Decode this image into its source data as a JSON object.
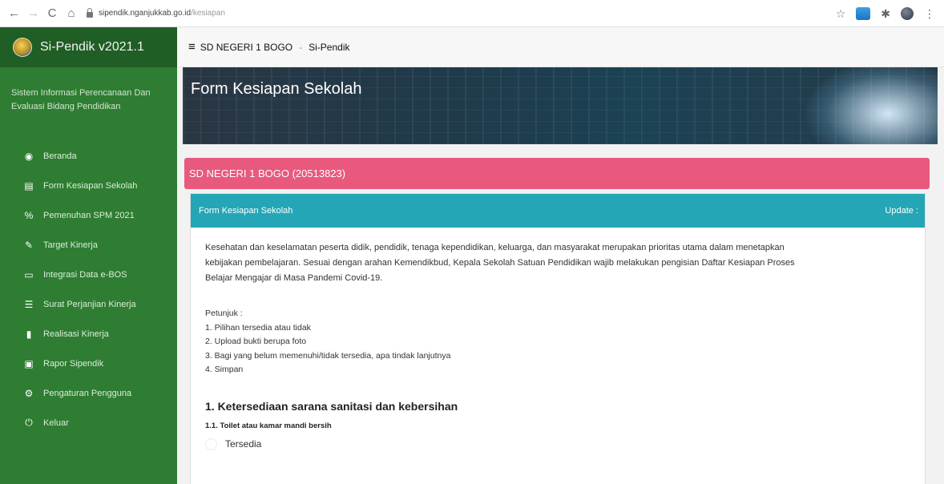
{
  "browser": {
    "url_host": "sipendik.nganjukkab.go.id",
    "url_path": "/kesiapan"
  },
  "sidebar": {
    "brand": "Si-Pendik v2021.1",
    "description": "Sistem Informasi Perencanaan Dan Evaluasi Bidang Pendidikan",
    "items": [
      {
        "label": "Beranda",
        "icon": "dashboard-icon"
      },
      {
        "label": "Form Kesiapan Sekolah",
        "icon": "file-icon"
      },
      {
        "label": "Pemenuhan SPM 2021",
        "icon": "percent-icon"
      },
      {
        "label": "Target Kinerja",
        "icon": "edit-icon"
      },
      {
        "label": "Integrasi Data e-BOS",
        "icon": "monitor-icon"
      },
      {
        "label": "Surat Perjanjian Kinerja",
        "icon": "list-icon"
      },
      {
        "label": "Realisasi Kinerja",
        "icon": "file-icon"
      },
      {
        "label": "Rapor Sipendik",
        "icon": "report-icon"
      },
      {
        "label": "Pengaturan Pengguna",
        "icon": "gears-icon"
      },
      {
        "label": "Keluar",
        "icon": "power-icon"
      }
    ]
  },
  "header": {
    "school": "SD NEGERI 1 BOGO",
    "separator": "-",
    "app": "Si-Pendik"
  },
  "banner": {
    "title": "Form Kesiapan Sekolah"
  },
  "school_bar": {
    "text": "SD NEGERI 1 BOGO (20513823)"
  },
  "panel": {
    "title": "Form Kesiapan Sekolah",
    "status": "Update :",
    "intro_1": "Kesehatan dan keselamatan peserta didik, pendidik, tenaga kependidikan, keluarga, dan masyarakat merupakan prioritas utama dalam menetapkan",
    "intro_2": "kebijakan pembelajaran. Sesuai dengan arahan Kemendikbud, Kepala Sekolah Satuan Pendidikan wajib melakukan pengisian Daftar Kesiapan Proses",
    "intro_3": "Belajar Mengajar di Masa Pandemi Covid-19.",
    "petunjuk_title": "Petunjuk :",
    "petunjuk": [
      "1. Pilihan tersedia atau tidak",
      "2. Upload bukti berupa foto",
      "3. Bagi yang belum memenuhi/tidak tersedia, apa tindak lanjutnya",
      "4. Simpan"
    ],
    "section_title": "1. Ketersediaan sarana sanitasi dan kebersihan",
    "sub_title": "1.1. Toilet atau kamar mandi bersih",
    "option": "Tersedia"
  }
}
